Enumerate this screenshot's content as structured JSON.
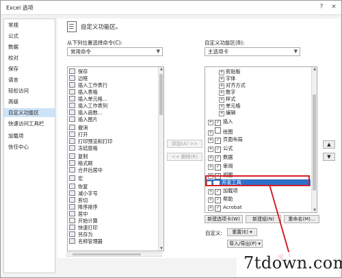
{
  "window": {
    "title": "Excel 选项",
    "help": "?",
    "close": "×"
  },
  "sidebar": {
    "items": [
      {
        "label": "常规"
      },
      {
        "label": "公式"
      },
      {
        "label": "数据"
      },
      {
        "label": "校对"
      },
      {
        "label": "保存"
      },
      {
        "label": "语言"
      },
      {
        "label": "轻松访问"
      },
      {
        "label": "高级"
      },
      {
        "label": "自定义功能区"
      },
      {
        "label": "快速访问工具栏"
      },
      {
        "label": "加载项"
      },
      {
        "label": "信任中心"
      }
    ]
  },
  "header": {
    "title": "自定义功能区。"
  },
  "left": {
    "choose_label": "从下列位置选择命令(C):",
    "choose_value": "常用命令",
    "commands": [
      {
        "label": "保存"
      },
      {
        "label": "边框"
      },
      {
        "label": "插入工作表行"
      },
      {
        "label": "插入表格"
      },
      {
        "label": "插入单元格..."
      },
      {
        "label": "插入工作表列"
      },
      {
        "label": "插入函数..."
      },
      {
        "label": "插入图片"
      },
      {
        "label": "撤消"
      },
      {
        "label": "打开"
      },
      {
        "label": "打印预览和打印"
      },
      {
        "label": "冻结窗格"
      },
      {
        "label": "复制"
      },
      {
        "label": "格式刷"
      },
      {
        "label": "合并后居中"
      },
      {
        "label": "宏"
      },
      {
        "label": "恢复"
      },
      {
        "label": "减小字号"
      },
      {
        "label": "剪切"
      },
      {
        "label": "降序排序"
      },
      {
        "label": "居中"
      },
      {
        "label": "开始计算"
      },
      {
        "label": "快速打印"
      },
      {
        "label": "另存为"
      },
      {
        "label": "名称管理器"
      }
    ]
  },
  "middle": {
    "add": "添加(A) >>",
    "remove": "<< 删除(R)"
  },
  "right": {
    "customize_label": "自定义功能区(B):",
    "customize_value": "主选项卡",
    "tree": [
      {
        "label": "剪贴板",
        "level": 2,
        "checkbox": false
      },
      {
        "label": "字体",
        "level": 2,
        "checkbox": false
      },
      {
        "label": "对齐方式",
        "level": 2,
        "checkbox": false
      },
      {
        "label": "数字",
        "level": 2,
        "checkbox": false
      },
      {
        "label": "样式",
        "level": 2,
        "checkbox": false
      },
      {
        "label": "单元格",
        "level": 2,
        "checkbox": false
      },
      {
        "label": "编辑",
        "level": 2,
        "checkbox": false
      },
      {
        "label": "插入",
        "level": 1,
        "checkbox": true,
        "checked": true
      },
      {
        "label": "绘图",
        "level": 1,
        "checkbox": true,
        "checked": false
      },
      {
        "label": "页面布局",
        "level": 1,
        "checkbox": true,
        "checked": true
      },
      {
        "label": "公式",
        "level": 1,
        "checkbox": true,
        "checked": true
      },
      {
        "label": "数据",
        "level": 1,
        "checkbox": true,
        "checked": true
      },
      {
        "label": "审阅",
        "level": 1,
        "checkbox": true,
        "checked": true
      },
      {
        "label": "视图",
        "level": 1,
        "checkbox": true,
        "checked": true
      },
      {
        "label": "开发工具",
        "level": 1,
        "checkbox": true,
        "checked": true,
        "selected": true
      },
      {
        "label": "加载项",
        "level": 1,
        "checkbox": true,
        "checked": true
      },
      {
        "label": "帮助",
        "level": 1,
        "checkbox": true,
        "checked": true
      },
      {
        "label": "Acrobat",
        "level": 1,
        "checkbox": true,
        "checked": true
      }
    ],
    "new_tab": "新建选项卡(W)",
    "new_group": "新建组(N)",
    "rename": "重命名(M)...",
    "customize_text": "自定义:",
    "reset": "重置(E) ▾",
    "import_export": "导入/导出(P) ▾",
    "move_up": "▲",
    "move_down": "▼"
  },
  "watermark": {
    "text": "7tdown.com"
  },
  "colors": {
    "highlight": "#d61f2a",
    "selection": "#2f6fc9",
    "sidebar_active": "#cde3f7"
  }
}
